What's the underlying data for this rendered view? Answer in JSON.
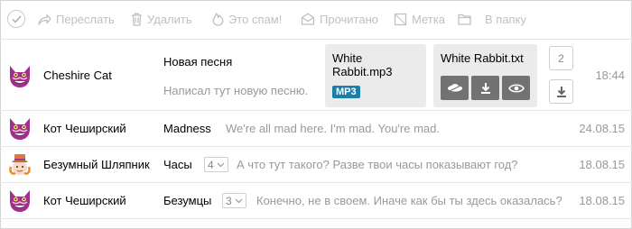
{
  "toolbar": {
    "forward_label": "Переслать",
    "delete_label": "Удалить",
    "spam_label": "Это спам!",
    "read_label": "Прочитано",
    "tag_label": "Метка",
    "folder_label": "В папку"
  },
  "messages": [
    {
      "sender": "Cheshire Cat",
      "subject": "Новая песня",
      "snippet": "Написал тут новую песню.",
      "date": "18:44",
      "attachments": [
        {
          "name": "White Rabbit.mp3",
          "badge": "MP3"
        },
        {
          "name": "White Rabbit.txt"
        }
      ],
      "attachment_count": "2"
    },
    {
      "sender": "Кот Чеширский",
      "subject": "Madness",
      "snippet": "We're all mad here. I'm mad. You're mad.",
      "date": "24.08.15"
    },
    {
      "sender": "Безумный Шляпник",
      "subject": "Часы",
      "thread_count": "4",
      "snippet": "А что тут такого? Разве твои часы показывают год?",
      "date": "18.08.15"
    },
    {
      "sender": "Кот Чеширский",
      "subject": "Безумцы",
      "thread_count": "3",
      "snippet": "Конечно, не в своем. Иначе как бы ты здесь оказалась?",
      "date": "18.08.15"
    }
  ],
  "colors": {
    "accent_badge": "#1b7fa8",
    "action_button": "#727272",
    "muted_text": "#999999",
    "disabled_toolbar": "#c0c0c0"
  },
  "icons": [
    "check-icon",
    "forward-icon",
    "trash-icon",
    "fire-icon",
    "envelope-icon",
    "tag-icon",
    "folder-icon",
    "cat-avatar",
    "hatter-avatar",
    "cloud-save-icon",
    "download-icon",
    "eye-icon",
    "chevron-down-icon"
  ]
}
